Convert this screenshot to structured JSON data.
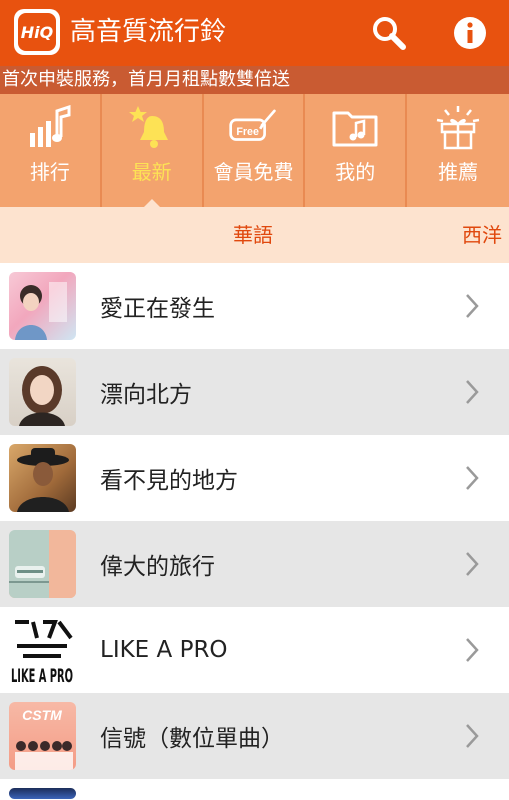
{
  "app": {
    "title": "高音質流行鈴",
    "logo_text": "HiQ"
  },
  "header": {
    "search_icon": "search-icon",
    "info_icon": "info-icon"
  },
  "banner": {
    "text": "首次申裝服務，首月月租點數雙倍送"
  },
  "nav": {
    "items": [
      {
        "label": "排行",
        "icon": "ranking-icon"
      },
      {
        "label": "最新",
        "icon": "new-bell-icon",
        "active": true
      },
      {
        "label": "會員免費",
        "icon": "free-ticket-icon",
        "badge": "Free"
      },
      {
        "label": "我的",
        "icon": "music-folder-icon"
      },
      {
        "label": "推薦",
        "icon": "gift-icon"
      }
    ]
  },
  "subtabs": {
    "active": "華語",
    "next": "西洋"
  },
  "songs": [
    {
      "title": "愛正在發生"
    },
    {
      "title": "漂向北方"
    },
    {
      "title": "看不見的地方"
    },
    {
      "title": "偉大的旅行"
    },
    {
      "title": "LIKE A PRO",
      "art_text": "LIKE A PRO"
    },
    {
      "title": "信號（數位單曲）",
      "art_text": "CSTM"
    }
  ],
  "colors": {
    "appbar": "#e8520f",
    "banner": "#c95b32",
    "nav": "#f3a36e",
    "active": "#fde255",
    "subtab_bg": "#fde3cf",
    "subtab_text": "#e0480e"
  }
}
